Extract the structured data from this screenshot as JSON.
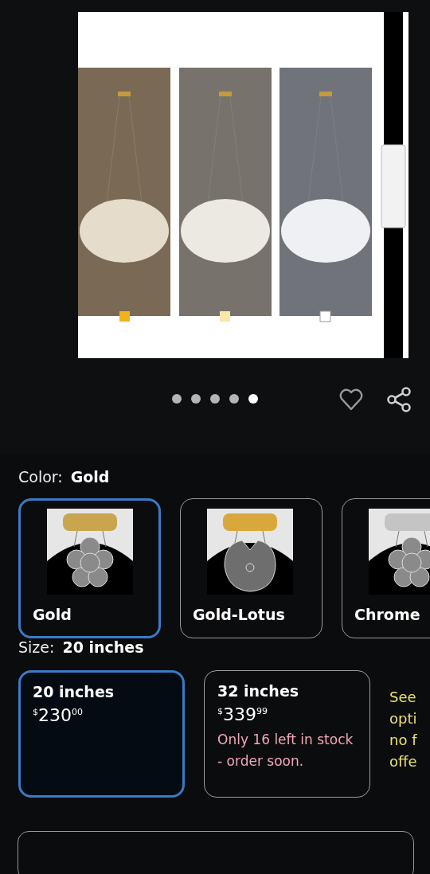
{
  "gallery": {
    "dots": [
      {
        "selected": false
      },
      {
        "selected": false
      },
      {
        "selected": false
      },
      {
        "selected": false
      },
      {
        "selected": true
      }
    ]
  },
  "color": {
    "label": "Color:",
    "value": "Gold",
    "options": [
      {
        "name": "Gold",
        "selected": true,
        "kind": "flower",
        "color": "#c9a550"
      },
      {
        "name": "Gold-Lotus",
        "selected": false,
        "kind": "lotus",
        "color": "#d9a83c"
      },
      {
        "name": "Chrome",
        "selected": false,
        "kind": "flower",
        "color": "#c4c4c4"
      }
    ]
  },
  "size": {
    "label": "Size:",
    "value": "20 inches",
    "options": [
      {
        "name": "20 inches",
        "selected": true,
        "currency": "$",
        "price": "230",
        "cents": "00"
      },
      {
        "name": "32 inches",
        "selected": false,
        "currency": "$",
        "price": "339",
        "cents": "99",
        "stock_note": "Only 16 left in stock - order soon."
      }
    ],
    "side_note": [
      "See",
      "opti",
      "no f",
      "offe"
    ]
  }
}
